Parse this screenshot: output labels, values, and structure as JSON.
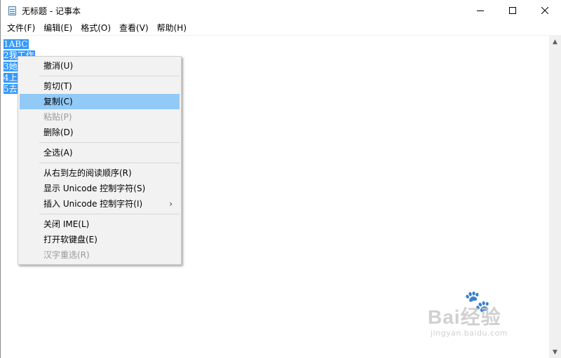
{
  "window": {
    "title": "无标题 - 记事本",
    "icon": "notepad-icon",
    "controls": [
      "minimize-icon",
      "maximize-icon",
      "close-icon"
    ]
  },
  "menubar": {
    "items": [
      {
        "label": "文件(F)"
      },
      {
        "label": "编辑(E)"
      },
      {
        "label": "格式(O)"
      },
      {
        "label": "查看(V)"
      },
      {
        "label": "帮助(H)"
      }
    ]
  },
  "editor": {
    "lines": [
      "1ABC",
      "2我工作",
      "3她",
      "4上",
      "5去"
    ],
    "selection_color": "#3399ff"
  },
  "context_menu": {
    "items": [
      {
        "label": "撤消(U)",
        "enabled": true
      },
      {
        "separator": true
      },
      {
        "label": "剪切(T)",
        "enabled": true
      },
      {
        "label": "复制(C)",
        "enabled": true,
        "highlighted": true
      },
      {
        "label": "粘贴(P)",
        "enabled": false
      },
      {
        "label": "删除(D)",
        "enabled": true
      },
      {
        "separator": true
      },
      {
        "label": "全选(A)",
        "enabled": true
      },
      {
        "separator": true
      },
      {
        "label": "从右到左的阅读顺序(R)",
        "enabled": true
      },
      {
        "label": "显示 Unicode 控制字符(S)",
        "enabled": true
      },
      {
        "label": "插入 Unicode 控制字符(I)",
        "enabled": true,
        "submenu": true
      },
      {
        "separator": true
      },
      {
        "label": "关闭 IME(L)",
        "enabled": true
      },
      {
        "label": "打开软键盘(E)",
        "enabled": true
      },
      {
        "label": "汉字重选(R)",
        "enabled": false
      }
    ],
    "highlight_color": "#91c9f7"
  },
  "watermark": {
    "brand": "Bai经验",
    "url": "jingyan.baidu.com"
  }
}
